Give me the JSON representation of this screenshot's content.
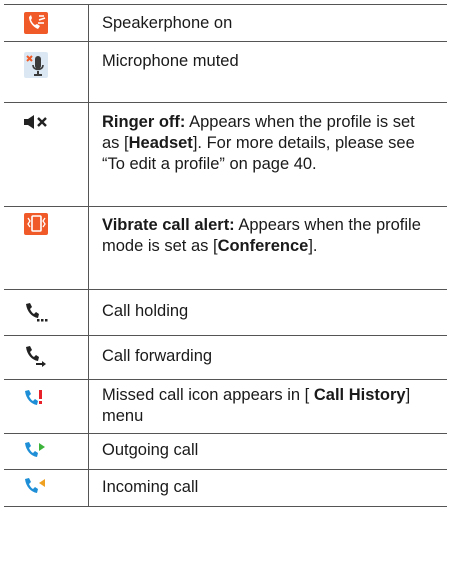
{
  "rows": [
    {
      "icon": "speakerphone-icon",
      "text": "Speakerphone on"
    },
    {
      "icon": "microphone-muted-icon",
      "text": "Microphone muted"
    },
    {
      "icon": "ringer-off-icon",
      "bold": "Ringer off:",
      "t1": " Appears when the profile is set as [",
      "b2": "Headset",
      "t2": "]. For more details, please see “To edit a profile” on page 40."
    },
    {
      "icon": "vibrate-icon",
      "bold": "Vibrate call alert:",
      "t1": " Appears when the profile mode is set as [",
      "b2": "Conference",
      "t2": "]."
    },
    {
      "icon": "call-holding-icon",
      "text": "Call holding"
    },
    {
      "icon": "call-forwarding-icon",
      "text": "Call forwarding"
    },
    {
      "icon": "missed-call-icon",
      "t1": "Missed call icon appears in [ ",
      "b2": "Call History",
      "t2": "] menu"
    },
    {
      "icon": "outgoing-call-icon",
      "text": "Outgoing call"
    },
    {
      "icon": "incoming-call-icon",
      "text": "Incoming call"
    }
  ],
  "colors": {
    "accent_orange": "#f05a28",
    "accent_blue": "#1e8fd6",
    "green": "#3cb43c"
  }
}
